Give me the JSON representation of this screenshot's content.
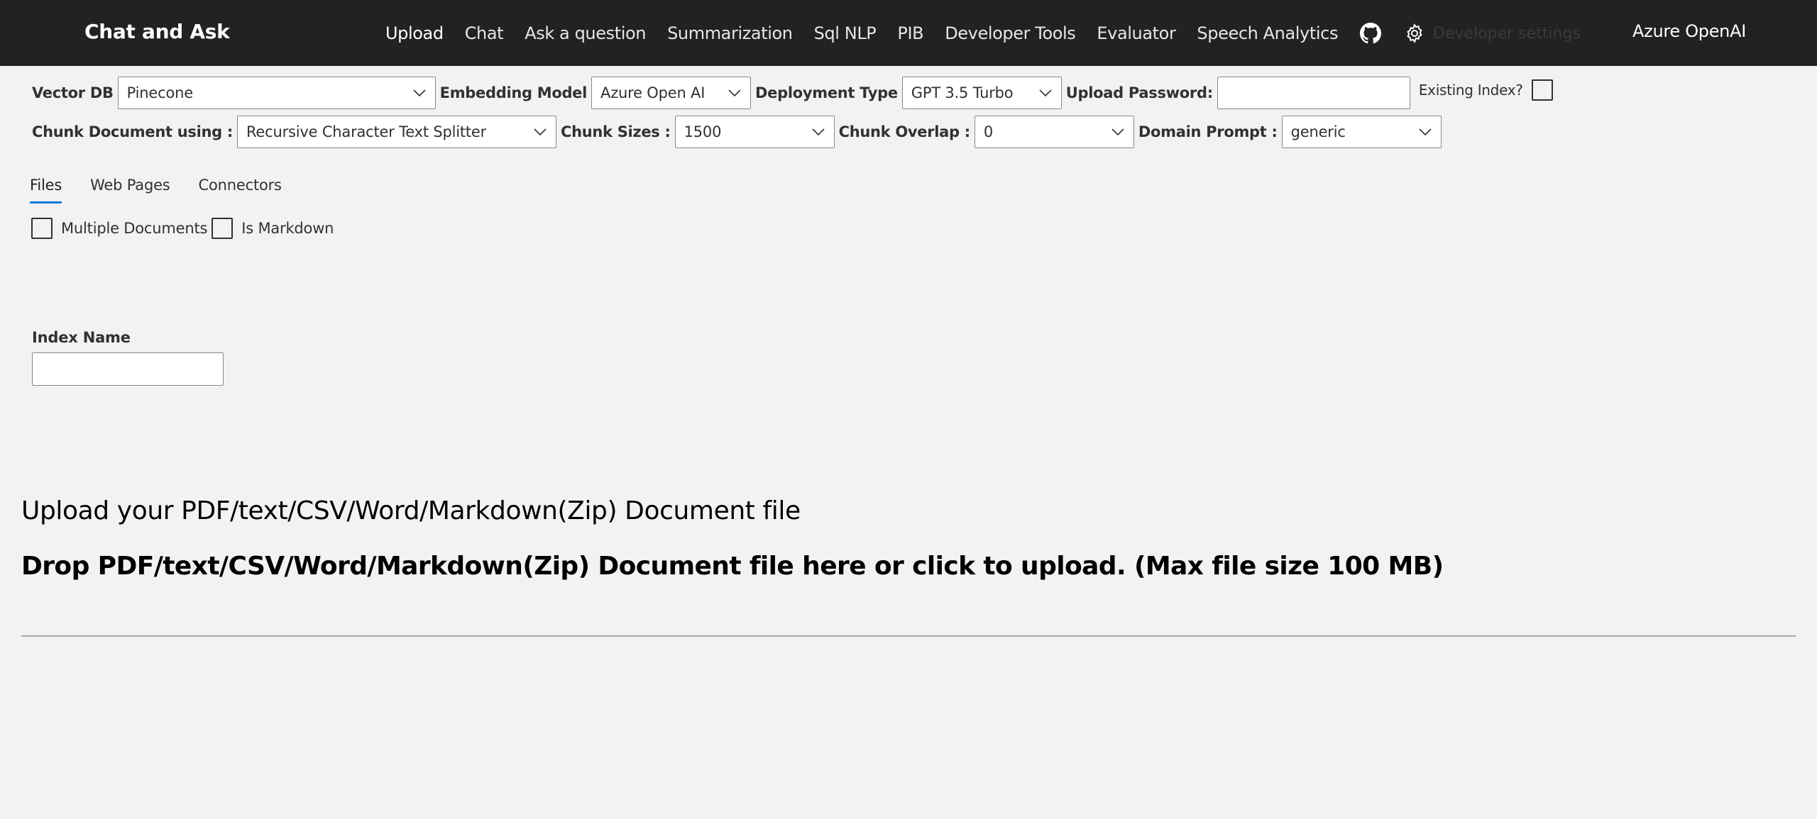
{
  "header": {
    "brand": "Chat and Ask",
    "nav": [
      "Upload",
      "Chat",
      "Ask a question",
      "Summarization",
      "Sql NLP",
      "PIB",
      "Developer Tools",
      "Evaluator",
      "Speech Analytics"
    ],
    "github_icon": "github-icon",
    "settings_icon": "gear-icon",
    "developer_settings": "Developer settings",
    "provider": "Azure OpenAI"
  },
  "options": {
    "vector_db_label": "Vector DB",
    "vector_db_value": "Pinecone",
    "embedding_label": "Embedding Model",
    "embedding_value": "Azure Open AI",
    "deployment_label": "Deployment Type",
    "deployment_value": "GPT 3.5 Turbo",
    "password_label": "Upload Password:",
    "password_value": "",
    "existing_index_label": "Existing Index?",
    "existing_index_checked": false,
    "chunk_using_label": "Chunk Document using :",
    "chunk_using_value": "Recursive Character Text Splitter",
    "chunk_sizes_label": "Chunk Sizes :",
    "chunk_sizes_value": "1500",
    "chunk_overlap_label": "Chunk Overlap :",
    "chunk_overlap_value": "0",
    "domain_prompt_label": "Domain Prompt :",
    "domain_prompt_value": "generic"
  },
  "tabs": [
    "Files",
    "Web Pages",
    "Connectors"
  ],
  "files": {
    "multiple_documents_label": "Multiple Documents",
    "is_markdown_label": "Is Markdown",
    "index_name_label": "Index Name",
    "index_name_value": "",
    "upload_title": "Upload your PDF/text/CSV/Word/Markdown(Zip) Document file",
    "drop_text": "Drop PDF/text/CSV/Word/Markdown(Zip) Document file here or click to upload. (Max file size 100 MB)"
  },
  "colors": {
    "header_bg": "#222222",
    "page_bg": "#f2f2f2",
    "tab_accent": "#0078d4"
  }
}
